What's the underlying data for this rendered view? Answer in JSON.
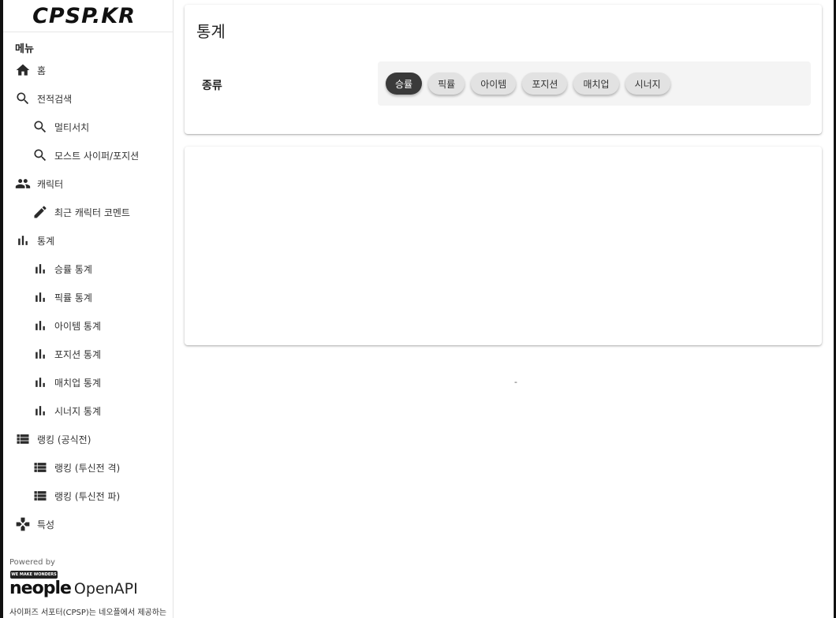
{
  "logo": "CPSP.KR",
  "sidebar": {
    "heading": "메뉴",
    "items": [
      {
        "label": "홈",
        "icon": "home-icon"
      },
      {
        "label": "전적검색",
        "icon": "search-icon"
      },
      {
        "label": "멀티서치",
        "icon": "search-icon"
      },
      {
        "label": "모스트 사이퍼/포지션",
        "icon": "search-icon"
      },
      {
        "label": "캐릭터",
        "icon": "people-icon"
      },
      {
        "label": "최근 캐릭터 코멘트",
        "icon": "pencil-icon"
      },
      {
        "label": "통계",
        "icon": "bar-chart-icon"
      },
      {
        "label": "승률 통계",
        "icon": "bar-chart-icon"
      },
      {
        "label": "픽률 통계",
        "icon": "bar-chart-icon"
      },
      {
        "label": "아이템 통계",
        "icon": "bar-chart-icon"
      },
      {
        "label": "포지션 통계",
        "icon": "bar-chart-icon"
      },
      {
        "label": "매치업 통계",
        "icon": "bar-chart-icon"
      },
      {
        "label": "시너지 통계",
        "icon": "bar-chart-icon"
      },
      {
        "label": "랭킹 (공식전)",
        "icon": "list-icon"
      },
      {
        "label": "랭킹 (투신전 격)",
        "icon": "list-icon"
      },
      {
        "label": "랭킹 (투신전 파)",
        "icon": "list-icon"
      },
      {
        "label": "특성",
        "icon": "gamepad-icon"
      }
    ],
    "powered_by": "Powered by",
    "wmw_badge": "WE MAKE WONDERS",
    "neople_brand": "neople",
    "openapi": "OpenAPI",
    "footer_note": "사이퍼즈 서포터(CPSP)는 네오플에서 제공하는"
  },
  "stats": {
    "title": "통계",
    "type_label": "종류",
    "chips": [
      "승률",
      "픽률",
      "아이템",
      "포지션",
      "매치업",
      "시너지"
    ],
    "active_chip": "승률"
  },
  "placeholder_dash": "-"
}
